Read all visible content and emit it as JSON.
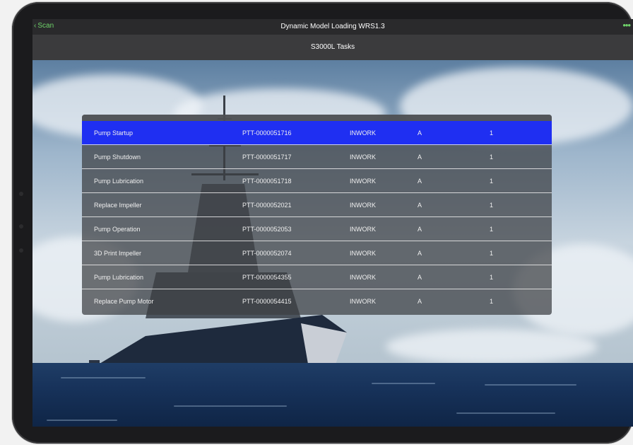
{
  "nav": {
    "back_label": "Scan",
    "title": "Dynamic Model Loading WRS1.3",
    "more_label": "•••"
  },
  "subnav": {
    "title": "S3000L Tasks"
  },
  "table": {
    "selected_index": 0,
    "rows": [
      {
        "name": "Pump Startup",
        "id": "PTT-0000051716",
        "status": "INWORK",
        "rev": "A",
        "count": "1"
      },
      {
        "name": "Pump Shutdown",
        "id": "PTT-0000051717",
        "status": "INWORK",
        "rev": "A",
        "count": "1"
      },
      {
        "name": "Pump Lubrication",
        "id": "PTT-0000051718",
        "status": "INWORK",
        "rev": "A",
        "count": "1"
      },
      {
        "name": "Replace Impeller",
        "id": "PTT-0000052021",
        "status": "INWORK",
        "rev": "A",
        "count": "1"
      },
      {
        "name": "Pump Operation",
        "id": "PTT-0000052053",
        "status": "INWORK",
        "rev": "A",
        "count": "1"
      },
      {
        "name": "3D Print Impeller",
        "id": "PTT-0000052074",
        "status": "INWORK",
        "rev": "A",
        "count": "1"
      },
      {
        "name": "Pump Lubrication",
        "id": "PTT-0000054355",
        "status": "INWORK",
        "rev": "A",
        "count": "1"
      },
      {
        "name": "Replace Pump Motor",
        "id": "PTT-0000054415",
        "status": "INWORK",
        "rev": "A",
        "count": "1"
      }
    ]
  },
  "colors": {
    "accent": "#6fd36a",
    "selected_row": "#1f2ff2",
    "nav_bg": "#2a2a2c",
    "subnav_bg": "#3b3b3d"
  }
}
